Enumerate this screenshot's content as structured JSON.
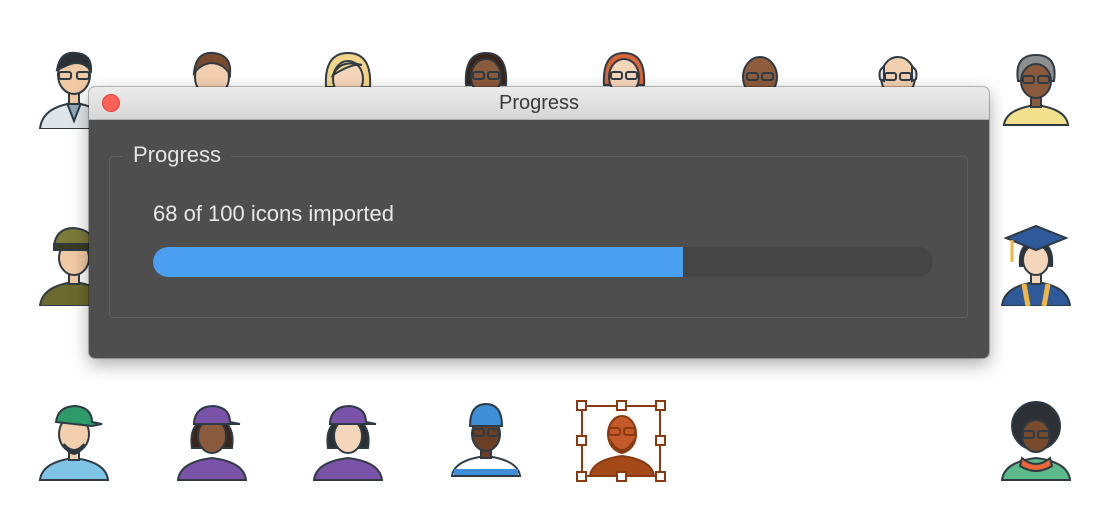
{
  "window": {
    "title": "Progress"
  },
  "group": {
    "label": "Progress"
  },
  "status": {
    "text": "68 of 100 icons imported",
    "imported": 68,
    "total": 100
  },
  "progress": {
    "fraction": 0.68
  },
  "colors": {
    "accent": "#4a9ff0",
    "dialog_bg": "#4e4e4e",
    "selection": "#8a3a10",
    "close": "#fe5f57"
  },
  "icons": {
    "row1": [
      "doctor-avatar-icon",
      "man-avatar-icon",
      "blonde-woman-avatar-icon",
      "woman-glasses-avatar-icon",
      "redhead-woman-avatar-icon",
      "bald-man-avatar-icon",
      "elderly-man-avatar-icon",
      "elderly-woman-avatar-icon"
    ],
    "row2": [
      "military-officer-avatar-icon",
      "graduate-avatar-icon"
    ],
    "row3": [
      "man-cap-avatar-icon",
      "woman-cap-avatar-icon",
      "woman-purple-cap-avatar-icon",
      "man-beanie-avatar-icon",
      "hipster-man-avatar-icon",
      "afro-woman-avatar-icon"
    ]
  }
}
